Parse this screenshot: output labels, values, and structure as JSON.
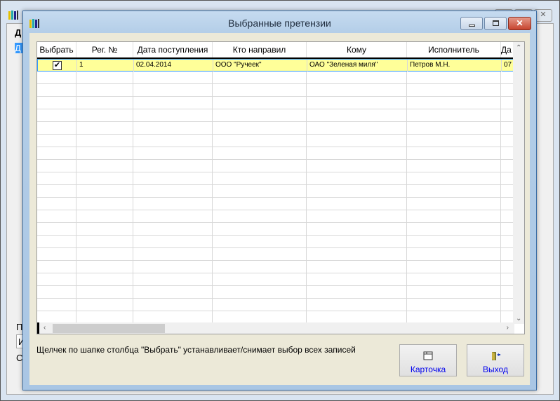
{
  "background_window": {
    "fragments": [
      "Д",
      "Д",
      "П",
      "И",
      "С"
    ]
  },
  "dialog": {
    "title": "Выбранные претензии",
    "controls": {
      "minimize": "—",
      "maximize": "□",
      "close": "✕"
    },
    "grid": {
      "columns": [
        "Выбрать",
        "Рег. №",
        "Дата поступления",
        "Кто направил",
        "Кому",
        "Исполнитель",
        "Да"
      ],
      "rows": [
        {
          "checked": true,
          "reg_no": "1",
          "date": "02.04.2014",
          "from": "ООО \"Ручеек\"",
          "to": "ОАО \"Зеленая миля\"",
          "executor": "Петров М.Н.",
          "extra": "07"
        }
      ]
    },
    "hint": "Щелчек по шапке столбца \"Выбрать\" устанавливает/снимает выбор всех записей",
    "buttons": {
      "card": "Карточка",
      "exit": "Выход"
    },
    "check_glyph": "✔"
  }
}
